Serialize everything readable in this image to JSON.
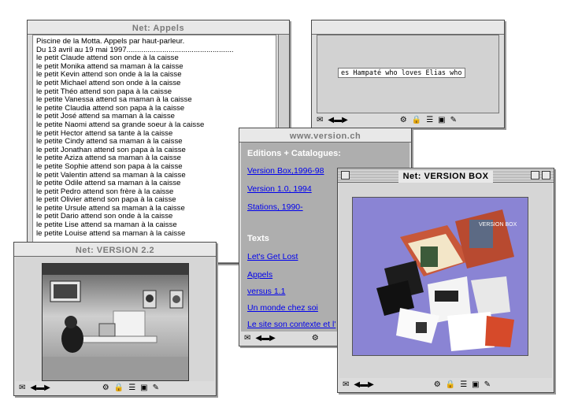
{
  "windows": {
    "appels": {
      "title": "Net: Appels",
      "header_line": "Piscine de la Motta. Appels par haut-parleur.",
      "date_line": "Du 13 avril au 19 mai 1997...................................................",
      "lines": [
        "le petit Claude attend son onde à la caisse",
        "le petit Monika attend sa maman à la caisse",
        "le petit Kevin attend son onde à la la caisse",
        "le petit Michael attend son onde à la caisse",
        "le petit Théo attend son papa à la caisse",
        "le petite Vanessa attend sa maman à la caisse",
        "le petite Claudia attend son papa à la caisse",
        "le petit José attend sa maman à la caisse",
        "le petite Naomi attend sa grande soeur à la caisse",
        "le petit Hector attend sa tante à la caisse",
        "le petite Cindy attend sa maman à la caisse",
        "le petit Jonathan attend son papa à la caisse",
        "le petite Aziza attend sa maman à la caisse",
        "le petite Sophie attend son papa à la caisse",
        "le petit Valentin attend sa maman à la caisse",
        "le petite Odile attend sa maman à la caisse",
        "le petit Pedro attend son frère à la caisse",
        "le petit Olivier attend son papa à la caisse",
        "le petite Ursule attend sa maman à la caisse",
        "le petit Dario attend son onde à la caisse",
        "le petite Lise attend sa maman à la caisse",
        "le petite Louise attend sa maman à la caisse"
      ]
    },
    "marquee_win": {
      "marquee_text": "es Hampaté who loves Elias who"
    },
    "version_ch": {
      "title": "www.version.ch",
      "heading_editions": "Editions + Catalogues:",
      "links_editions": [
        "Version Box,1996-98",
        "Version 1.0, 1994",
        "Stations, 1990-"
      ],
      "heading_texts": "Texts",
      "links_texts": [
        "Let's Get Lost",
        "Appels",
        "versus 1.1",
        "Un monde chez soi",
        "Le site son contexte et l'"
      ]
    },
    "version22": {
      "title": "Net: VERSION 2.2"
    },
    "versionbox": {
      "title": "Net: VERSION BOX",
      "box_lid_label": "VERSION BOX"
    }
  },
  "colors": {
    "window_gray": "#dcdcdc",
    "link_blue": "#0000ee",
    "version_ch_bg": "#aeaeae",
    "photo_purple": "#8a84d4"
  },
  "status_icons": [
    "mail-icon",
    "connection-icon",
    "network-icon",
    "security-icon",
    "news-icon",
    "bookmark-icon",
    "edit-icon"
  ]
}
